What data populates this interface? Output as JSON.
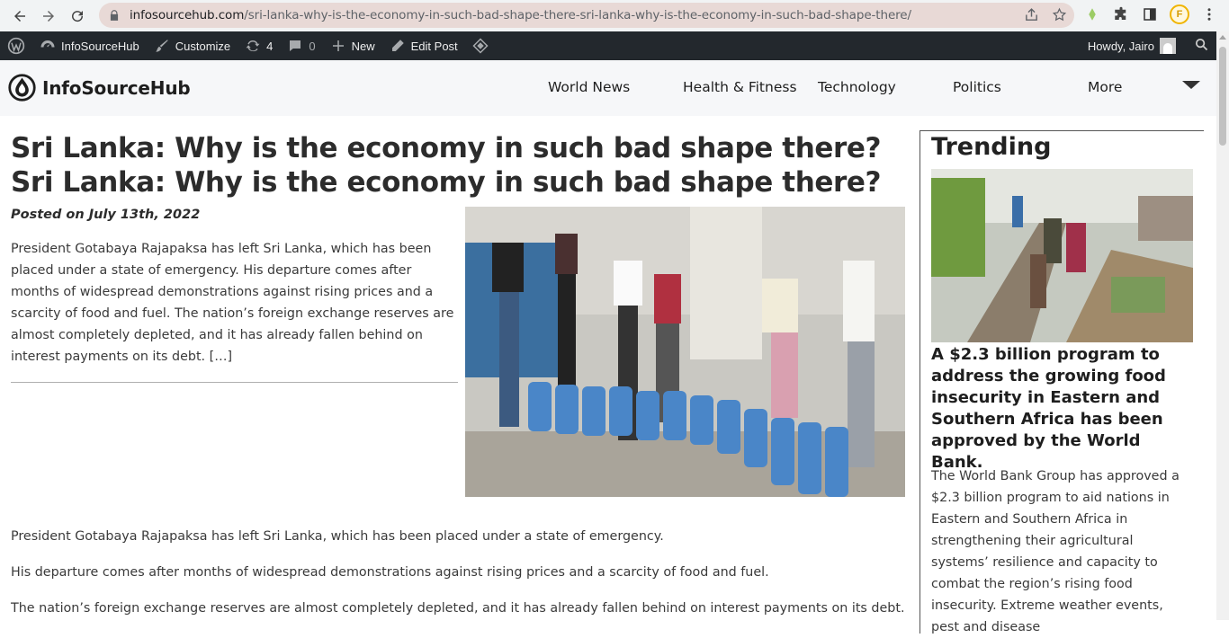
{
  "browser": {
    "url_host": "infosourcehub.com",
    "url_path": "/sri-lanka-why-is-the-economy-in-such-bad-shape-there-sri-lanka-why-is-the-economy-in-such-bad-shape-there/",
    "profile_initial": "F"
  },
  "adminbar": {
    "site_name": "InfoSourceHub",
    "customize": "Customize",
    "updates_count": "4",
    "comments_count": "0",
    "new_label": "New",
    "edit_post": "Edit Post",
    "howdy": "Howdy, Jairo"
  },
  "site": {
    "logo_text": "InfoSourceHub",
    "menu": [
      "World News",
      "Health & Fitness",
      "Technology",
      "Politics",
      "More"
    ]
  },
  "article": {
    "title": "Sri Lanka: Why is the economy in such bad shape there? Sri Lanka: Why is the economy in such bad shape there?",
    "posted": "Posted on July 13th, 2022",
    "excerpt": "President Gotabaya Rajapaksa has left Sri Lanka, which has been placed under a state of emergency. His departure comes after months of widespread demonstrations against rising prices and a scarcity of food and fuel. The nation’s foreign exchange reserves are almost completely depleted, and it has already fallen behind on interest payments on its debt. […]",
    "paragraphs": [
      "President Gotabaya Rajapaksa has left Sri Lanka, which has been placed under a state of emergency.",
      "His departure comes after months of widespread demonstrations against rising prices and a scarcity of food and fuel.",
      "The nation’s foreign exchange reserves are almost completely depleted, and it has already fallen behind on interest payments on its debt."
    ]
  },
  "sidebar": {
    "title": "Trending",
    "headline": "A $2.3 billion program to address the growing food insecurity in Eastern and Southern Africa has been approved by the World Bank.",
    "text": "The World Bank Group has approved a $2.3 billion program to aid nations in Eastern and Southern Africa in strengthening their agricultural systems’ resilience and capacity to combat the region’s rising food insecurity. Extreme weather events, pest and disease"
  },
  "colors": {
    "adminbar_bg": "#23282d",
    "header_bg": "#f6f7f9",
    "omnibox_bg": "#e8d9d6",
    "text": "#2c2c2c"
  }
}
